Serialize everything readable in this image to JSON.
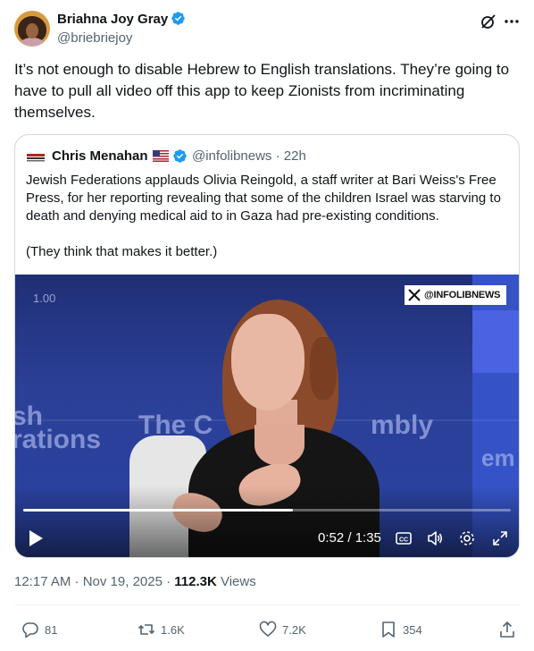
{
  "author": {
    "name": "Briahna Joy Gray",
    "handle": "@briebriejoy",
    "verified": true
  },
  "tweet_text": "It’s not enough to disable Hebrew to English translations. They’re going to have to pull all video off this app to keep Zionists from incriminating themselves.",
  "quoted": {
    "name": "Chris Menahan",
    "flag": "us-flag-icon",
    "handle_time": "@infolibnews · 22h",
    "paragraphs": [
      "Jewish Federations applauds Olivia Reingold, a staff writer at Bari Weiss's Free Press, for her reporting revealing that some of the children Israel was starving to death and denying medical aid to in Gaza had pre-existing conditions.",
      "(They think that makes it better.)"
    ],
    "video": {
      "speed_label": "1.00",
      "watermark": "@INFOLIBNEWS",
      "background_text": [
        "sh",
        "rations",
        "The C",
        "mbly",
        "em"
      ],
      "time": "0:52 / 1:35",
      "progress": 0.554
    }
  },
  "meta": {
    "time_date": "12:17 AM · Nov 19, 2025 · ",
    "views_count": "112.3K",
    "views_label": " Views"
  },
  "actions": {
    "replies": "81",
    "reposts": "1.6K",
    "likes": "7.2K",
    "bookmarks": "354"
  },
  "colors": {
    "verified": "#1d9bf0",
    "secondary_text": "#536471",
    "border": "#cfd9de"
  }
}
